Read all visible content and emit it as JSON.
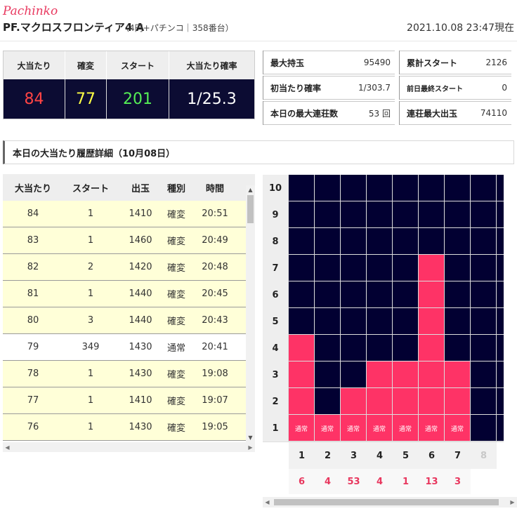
{
  "header": {
    "brand": "Pachinko",
    "model": "PF.マクロスフロンティア4 A",
    "machine_info": "（4円+パチンコ｜358番台）",
    "datetime": "2021.10.08 23:47現在"
  },
  "summary": {
    "headers": [
      "大当たり",
      "確変",
      "スタート",
      "大当たり確率"
    ],
    "values": [
      "84",
      "77",
      "201",
      "1/25.3"
    ],
    "value_colors": [
      "#ff4444",
      "#ffff44",
      "#55ee55",
      "#ffffff"
    ]
  },
  "stats": [
    {
      "label": "最大持玉",
      "value": "95490"
    },
    {
      "label": "累計スタート",
      "value": "2126"
    },
    {
      "label": "初当たり確率",
      "value": "1/303.7"
    },
    {
      "label": "前日最終スタート",
      "value": "0"
    },
    {
      "label": "本日の最大連荘数",
      "value": "53 回"
    },
    {
      "label": "連荘最大出玉",
      "value": "74110"
    }
  ],
  "section_title": "本日の大当たり履歴詳細（10月08日）",
  "history": {
    "columns": [
      "大当たり",
      "スタート",
      "出玉",
      "種別",
      "時間"
    ],
    "rows": [
      {
        "no": "84",
        "start": "1",
        "payout": "1410",
        "type": "確変",
        "time": "20:51",
        "kind": "kakuhen"
      },
      {
        "no": "83",
        "start": "1",
        "payout": "1460",
        "type": "確変",
        "time": "20:49",
        "kind": "kakuhen"
      },
      {
        "no": "82",
        "start": "2",
        "payout": "1420",
        "type": "確変",
        "time": "20:48",
        "kind": "kakuhen"
      },
      {
        "no": "81",
        "start": "1",
        "payout": "1440",
        "type": "確変",
        "time": "20:45",
        "kind": "kakuhen"
      },
      {
        "no": "80",
        "start": "3",
        "payout": "1440",
        "type": "確変",
        "time": "20:43",
        "kind": "kakuhen"
      },
      {
        "no": "79",
        "start": "349",
        "payout": "1430",
        "type": "通常",
        "time": "20:41",
        "kind": "normal"
      },
      {
        "no": "78",
        "start": "1",
        "payout": "1430",
        "type": "確変",
        "time": "19:08",
        "kind": "kakuhen"
      },
      {
        "no": "77",
        "start": "1",
        "payout": "1410",
        "type": "確変",
        "time": "19:07",
        "kind": "kakuhen"
      },
      {
        "no": "76",
        "start": "1",
        "payout": "1430",
        "type": "確変",
        "time": "19:05",
        "kind": "kakuhen"
      }
    ]
  },
  "chain_graph": {
    "y_labels": [
      "10",
      "9",
      "8",
      "7",
      "6",
      "5",
      "4",
      "3",
      "2",
      "1"
    ],
    "x_labels": [
      "1",
      "2",
      "3",
      "4",
      "5",
      "6",
      "7",
      "8"
    ],
    "chain_counts": [
      "6",
      "4",
      "53",
      "4",
      "1",
      "13",
      "3"
    ],
    "filled_levels": [
      4,
      1,
      2,
      3,
      3,
      7,
      3
    ],
    "bar_type_label": "通常",
    "colors": {
      "empty": "#020032",
      "filled": "#fe3366",
      "chain_text": "#e8375e"
    }
  }
}
